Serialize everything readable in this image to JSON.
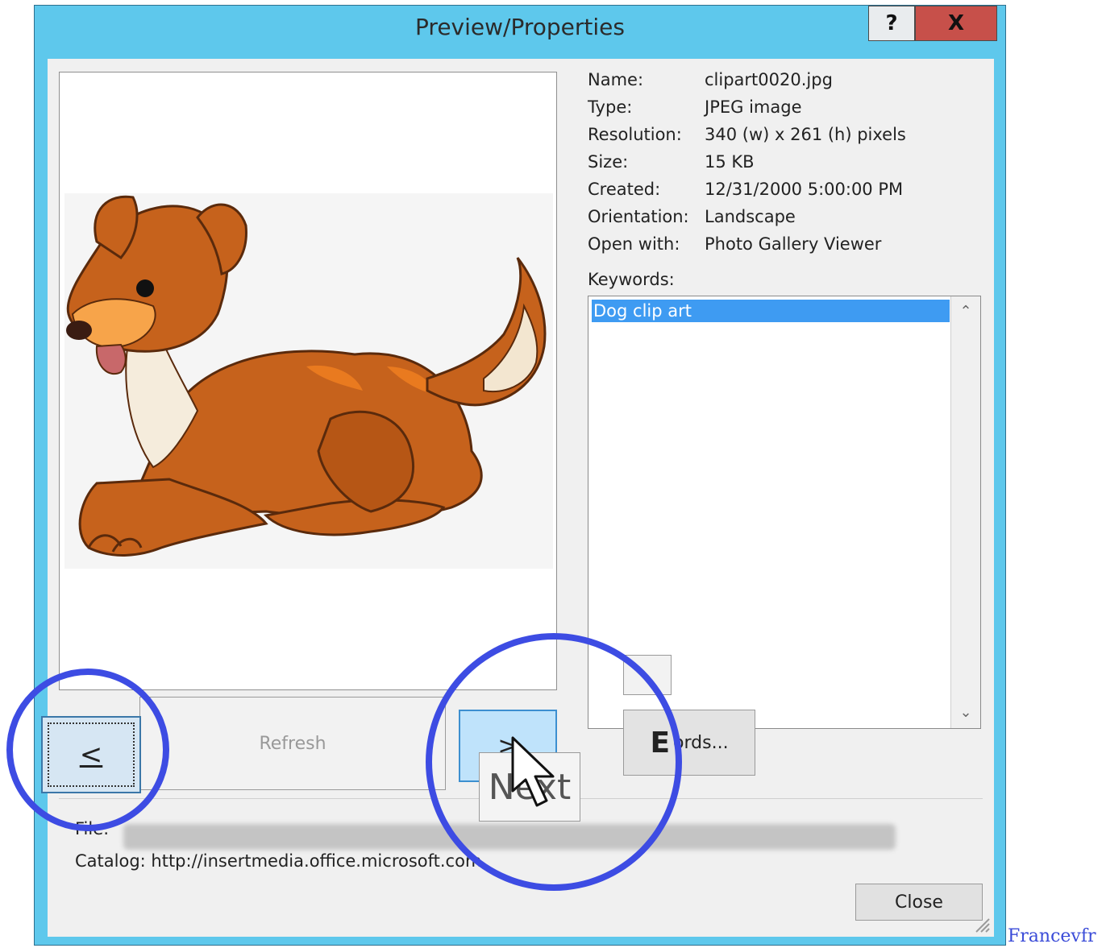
{
  "dialog": {
    "title": "Preview/Properties",
    "help_label": "?",
    "close_label": "X"
  },
  "properties": [
    {
      "label": "Name:",
      "value": "clipart0020.jpg"
    },
    {
      "label": "Type:",
      "value": "JPEG image"
    },
    {
      "label": "Resolution:",
      "value": "340 (w) x 261 (h) pixels"
    },
    {
      "label": "Size:",
      "value": "15 KB"
    },
    {
      "label": "Created:",
      "value": "12/31/2000 5:00:00 PM"
    },
    {
      "label": "Orientation:",
      "value": "Landscape"
    },
    {
      "label": "Open with:",
      "value": "Photo Gallery Viewer"
    }
  ],
  "keywords": {
    "label": "Keywords:",
    "items": [
      "Dog clip art"
    ]
  },
  "buttons": {
    "prev": "<",
    "refresh": "Refresh",
    "next": ">",
    "edit_big": "E",
    "edit_rest": "ords...",
    "close": "Close"
  },
  "footer": {
    "file_label": "File:",
    "catalog": "Catalog: http://insertmedia.office.microsoft.com"
  },
  "tooltip": "Next",
  "watermark": "Francevfr",
  "colors": {
    "title_bar": "#5ec8ec",
    "close_button": "#c7504a",
    "selection": "#3e9bf2",
    "highlight_circle": "#3d4ce3"
  }
}
